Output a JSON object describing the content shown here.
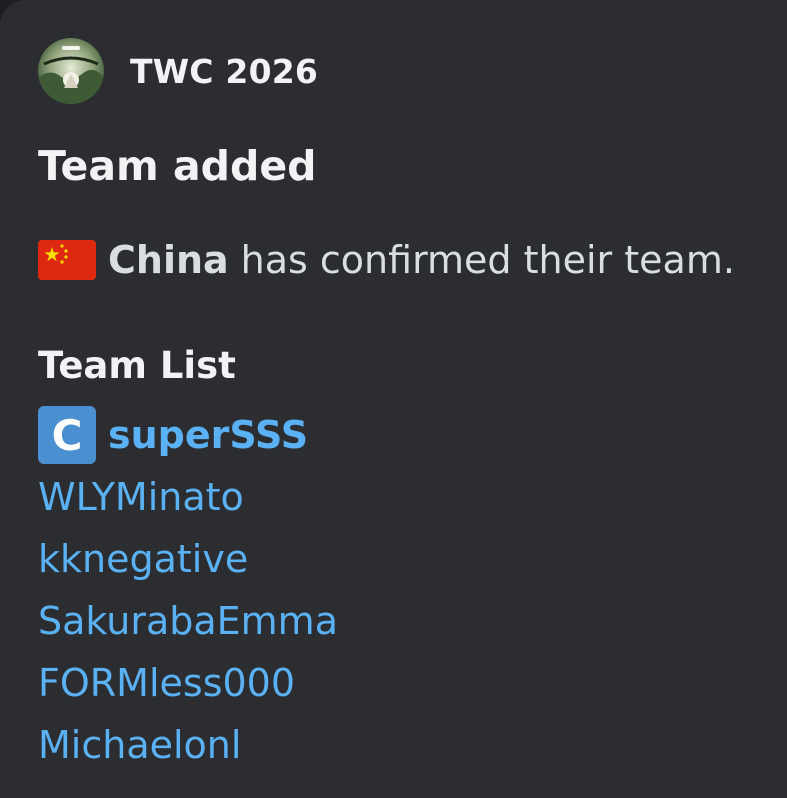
{
  "author": {
    "name": "TWC 2026",
    "avatar_icon": "tournament-logo-icon"
  },
  "embed": {
    "title": "Team added",
    "description": {
      "flag_icon": "china-flag-icon",
      "country": "China",
      "rest": "has confirmed their team."
    },
    "field": {
      "name": "Team List",
      "captain_badge": "C",
      "players": [
        {
          "name": "superSSS",
          "captain": true
        },
        {
          "name": "WLYMinato",
          "captain": false
        },
        {
          "name": "kknegative",
          "captain": false
        },
        {
          "name": "SakurabaEmma",
          "captain": false
        },
        {
          "name": "FORMless000",
          "captain": false
        },
        {
          "name": "Michaelonl",
          "captain": false
        }
      ]
    }
  },
  "colors": {
    "background": "#2b2d31",
    "text": "#dbdee1",
    "link": "#5ab1f3",
    "captain_badge": "#4a8fd0",
    "flag_red": "#de2910",
    "flag_yellow": "#ffde00"
  }
}
